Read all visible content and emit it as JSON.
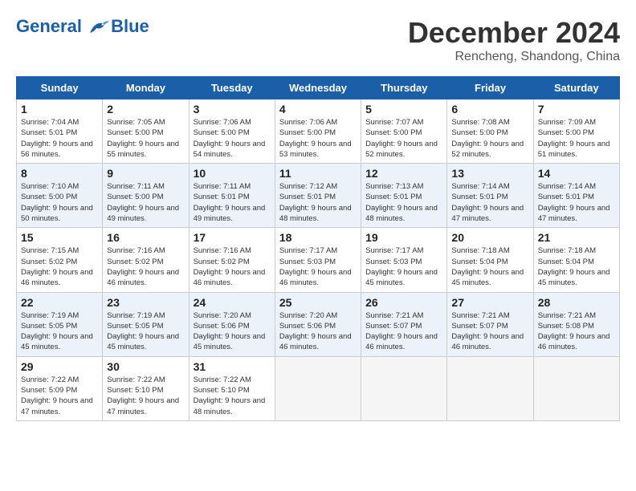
{
  "header": {
    "logo_line1": "General",
    "logo_line2": "Blue",
    "month": "December 2024",
    "location": "Rencheng, Shandong, China"
  },
  "weekdays": [
    "Sunday",
    "Monday",
    "Tuesday",
    "Wednesday",
    "Thursday",
    "Friday",
    "Saturday"
  ],
  "weeks": [
    [
      {
        "day": "1",
        "sunrise": "7:04 AM",
        "sunset": "5:01 PM",
        "daylight": "9 hours and 56 minutes."
      },
      {
        "day": "2",
        "sunrise": "7:05 AM",
        "sunset": "5:00 PM",
        "daylight": "9 hours and 55 minutes."
      },
      {
        "day": "3",
        "sunrise": "7:06 AM",
        "sunset": "5:00 PM",
        "daylight": "9 hours and 54 minutes."
      },
      {
        "day": "4",
        "sunrise": "7:06 AM",
        "sunset": "5:00 PM",
        "daylight": "9 hours and 53 minutes."
      },
      {
        "day": "5",
        "sunrise": "7:07 AM",
        "sunset": "5:00 PM",
        "daylight": "9 hours and 52 minutes."
      },
      {
        "day": "6",
        "sunrise": "7:08 AM",
        "sunset": "5:00 PM",
        "daylight": "9 hours and 52 minutes."
      },
      {
        "day": "7",
        "sunrise": "7:09 AM",
        "sunset": "5:00 PM",
        "daylight": "9 hours and 51 minutes."
      }
    ],
    [
      {
        "day": "8",
        "sunrise": "7:10 AM",
        "sunset": "5:00 PM",
        "daylight": "9 hours and 50 minutes."
      },
      {
        "day": "9",
        "sunrise": "7:11 AM",
        "sunset": "5:00 PM",
        "daylight": "9 hours and 49 minutes."
      },
      {
        "day": "10",
        "sunrise": "7:11 AM",
        "sunset": "5:01 PM",
        "daylight": "9 hours and 49 minutes."
      },
      {
        "day": "11",
        "sunrise": "7:12 AM",
        "sunset": "5:01 PM",
        "daylight": "9 hours and 48 minutes."
      },
      {
        "day": "12",
        "sunrise": "7:13 AM",
        "sunset": "5:01 PM",
        "daylight": "9 hours and 48 minutes."
      },
      {
        "day": "13",
        "sunrise": "7:14 AM",
        "sunset": "5:01 PM",
        "daylight": "9 hours and 47 minutes."
      },
      {
        "day": "14",
        "sunrise": "7:14 AM",
        "sunset": "5:01 PM",
        "daylight": "9 hours and 47 minutes."
      }
    ],
    [
      {
        "day": "15",
        "sunrise": "7:15 AM",
        "sunset": "5:02 PM",
        "daylight": "9 hours and 46 minutes."
      },
      {
        "day": "16",
        "sunrise": "7:16 AM",
        "sunset": "5:02 PM",
        "daylight": "9 hours and 46 minutes."
      },
      {
        "day": "17",
        "sunrise": "7:16 AM",
        "sunset": "5:02 PM",
        "daylight": "9 hours and 46 minutes."
      },
      {
        "day": "18",
        "sunrise": "7:17 AM",
        "sunset": "5:03 PM",
        "daylight": "9 hours and 46 minutes."
      },
      {
        "day": "19",
        "sunrise": "7:17 AM",
        "sunset": "5:03 PM",
        "daylight": "9 hours and 45 minutes."
      },
      {
        "day": "20",
        "sunrise": "7:18 AM",
        "sunset": "5:04 PM",
        "daylight": "9 hours and 45 minutes."
      },
      {
        "day": "21",
        "sunrise": "7:18 AM",
        "sunset": "5:04 PM",
        "daylight": "9 hours and 45 minutes."
      }
    ],
    [
      {
        "day": "22",
        "sunrise": "7:19 AM",
        "sunset": "5:05 PM",
        "daylight": "9 hours and 45 minutes."
      },
      {
        "day": "23",
        "sunrise": "7:19 AM",
        "sunset": "5:05 PM",
        "daylight": "9 hours and 45 minutes."
      },
      {
        "day": "24",
        "sunrise": "7:20 AM",
        "sunset": "5:06 PM",
        "daylight": "9 hours and 45 minutes."
      },
      {
        "day": "25",
        "sunrise": "7:20 AM",
        "sunset": "5:06 PM",
        "daylight": "9 hours and 46 minutes."
      },
      {
        "day": "26",
        "sunrise": "7:21 AM",
        "sunset": "5:07 PM",
        "daylight": "9 hours and 46 minutes."
      },
      {
        "day": "27",
        "sunrise": "7:21 AM",
        "sunset": "5:07 PM",
        "daylight": "9 hours and 46 minutes."
      },
      {
        "day": "28",
        "sunrise": "7:21 AM",
        "sunset": "5:08 PM",
        "daylight": "9 hours and 46 minutes."
      }
    ],
    [
      {
        "day": "29",
        "sunrise": "7:22 AM",
        "sunset": "5:09 PM",
        "daylight": "9 hours and 47 minutes."
      },
      {
        "day": "30",
        "sunrise": "7:22 AM",
        "sunset": "5:10 PM",
        "daylight": "9 hours and 47 minutes."
      },
      {
        "day": "31",
        "sunrise": "7:22 AM",
        "sunset": "5:10 PM",
        "daylight": "9 hours and 48 minutes."
      },
      null,
      null,
      null,
      null
    ]
  ]
}
